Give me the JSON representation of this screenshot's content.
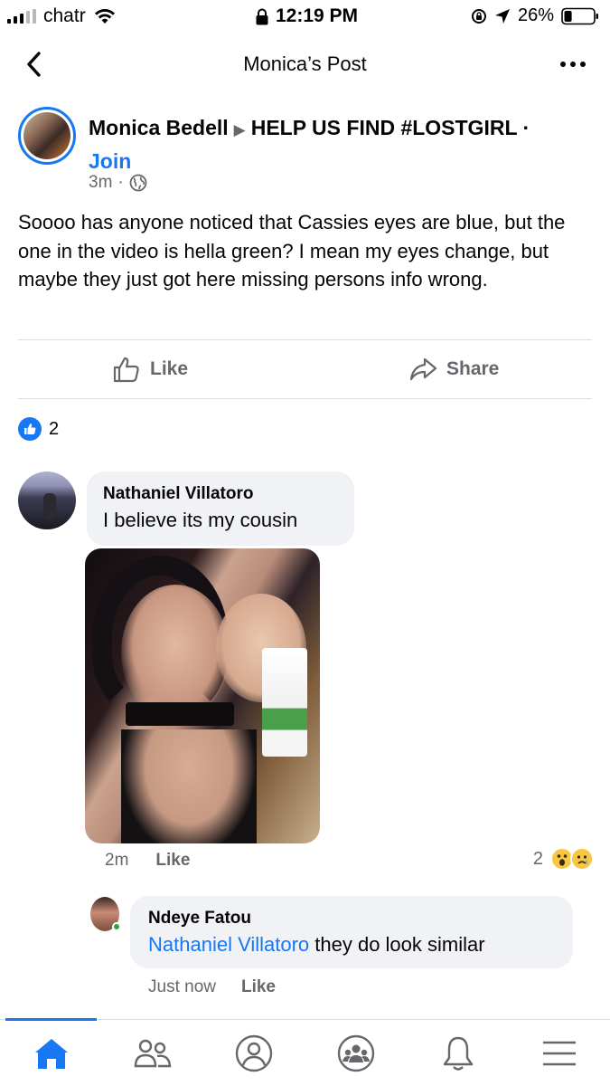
{
  "status_bar": {
    "carrier": "chatr",
    "time": "12:19 PM",
    "battery_percent": "26%",
    "battery_level": 0.26,
    "icons": [
      "signal-icon",
      "wifi-icon",
      "lock-icon",
      "rotation-lock-icon",
      "location-arrow-icon",
      "battery-icon"
    ]
  },
  "header": {
    "title": "Monica’s Post",
    "back_icon": "chevron-left-icon",
    "more_icon": "ellipsis-icon"
  },
  "post": {
    "author": "Monica Bedell",
    "group": "HELP US FIND #LOSTGIRL",
    "separator": "·",
    "join_label": "Join",
    "time": "3m",
    "meta_dot": "·",
    "privacy_icon": "globe-icon",
    "text": "Soooo has anyone noticed that Cassies eyes are blue, but the one in the video is hella green? I mean my eyes change, but maybe they just got here missing persons info wrong.",
    "like_label": "Like",
    "share_label": "Share",
    "reaction_count": "2"
  },
  "comments": [
    {
      "author": "Nathaniel Villatoro",
      "text": "I believe its my cousin",
      "time": "2m",
      "like_label": "Like",
      "reaction_count": "2",
      "reactions": [
        "wow",
        "sad"
      ],
      "has_photo": true
    }
  ],
  "reply": {
    "author": "Ndeye Fatou",
    "mention": "Nathaniel Villatoro",
    "text": " they do look similar",
    "time": "Just now",
    "like_label": "Like"
  },
  "tabbar": {
    "tabs": [
      "home-icon",
      "friends-icon",
      "profile-icon",
      "groups-icon",
      "notifications-icon",
      "menu-icon"
    ],
    "active": "home-icon",
    "accent": "#1877f2"
  },
  "colors": {
    "accent": "#1877f2",
    "secondary_text": "#65676b",
    "bubble_bg": "#f0f2f5"
  }
}
